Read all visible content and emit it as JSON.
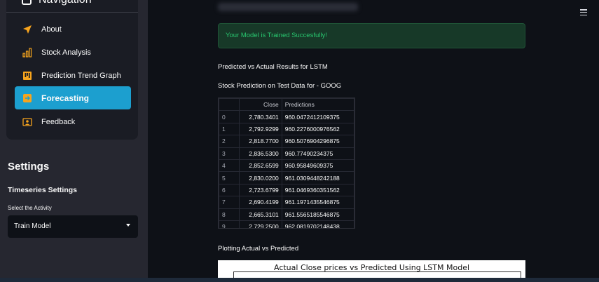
{
  "sidebar": {
    "nav_title": "Navigation",
    "items": [
      {
        "label": "About",
        "icon": "paper-plane-icon",
        "active": false
      },
      {
        "label": "Stock Analysis",
        "icon": "bar-chart-icon",
        "active": false
      },
      {
        "label": "Prediction Trend Graph",
        "icon": "trend-graph-icon",
        "active": false
      },
      {
        "label": "Forecasting",
        "icon": "arrow-right-square-icon",
        "active": true
      },
      {
        "label": "Feedback",
        "icon": "person-card-icon",
        "active": false
      }
    ],
    "settings_title": "Settings",
    "timeseries_title": "Timeseries Settings",
    "select_label": "Select the Activity",
    "select_value": "Train Model"
  },
  "main": {
    "success_message": "Your Model is Trained Succesfully!",
    "results_title": "Predicted vs Actual Results for LSTM",
    "table_title": "Stock Prediction on Test Data for - GOOG",
    "table": {
      "headers": [
        "",
        "Close",
        "Predictions"
      ],
      "rows": [
        [
          "0",
          "2,780.3401",
          "960.0472412109375"
        ],
        [
          "1",
          "2,792.9299",
          "960.2276000976562"
        ],
        [
          "2",
          "2,818.7700",
          "960.5076904296875"
        ],
        [
          "3",
          "2,836.5300",
          "960.77490234375"
        ],
        [
          "4",
          "2,852.6599",
          "960.95849609375"
        ],
        [
          "5",
          "2,830.0200",
          "961.0309448242188"
        ],
        [
          "6",
          "2,723.6799",
          "961.0469360351562"
        ],
        [
          "7",
          "2,690.4199",
          "961.1971435546875"
        ],
        [
          "8",
          "2,665.3101",
          "961.5565185546875"
        ],
        [
          "9",
          "2,729.2500",
          "962.0819702148438"
        ]
      ]
    },
    "plot_section_title": "Plotting Actual vs Predicted",
    "plot_title": "Actual Close prices vs Predicted Using LSTM Model"
  },
  "colors": {
    "accent": "#1c9fcf",
    "success_text": "#28c76f",
    "icon_orange": "#f7a41d"
  }
}
